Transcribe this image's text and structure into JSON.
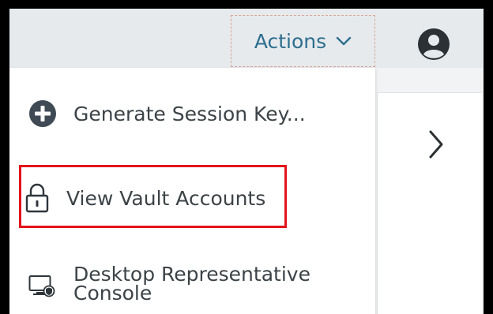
{
  "header": {
    "actions_label": "Actions",
    "actions_icon": "chevron-down-icon",
    "user_icon": "user-circle-icon"
  },
  "menu": {
    "items": [
      {
        "label": "Generate Session Key...",
        "icon": "plus-circle-icon"
      },
      {
        "label": "View Vault Accounts",
        "icon": "lock-icon",
        "highlighted": true
      },
      {
        "label_lines": [
          "Desktop Representative",
          "Console"
        ],
        "icon": "desktop-console-icon"
      }
    ]
  },
  "side_panel": {
    "icon": "chevron-right-icon"
  },
  "colors": {
    "accent": "#2e6e8e",
    "topbar": "#e6eaed",
    "highlight": "#e2141b",
    "text": "#3c4347"
  }
}
